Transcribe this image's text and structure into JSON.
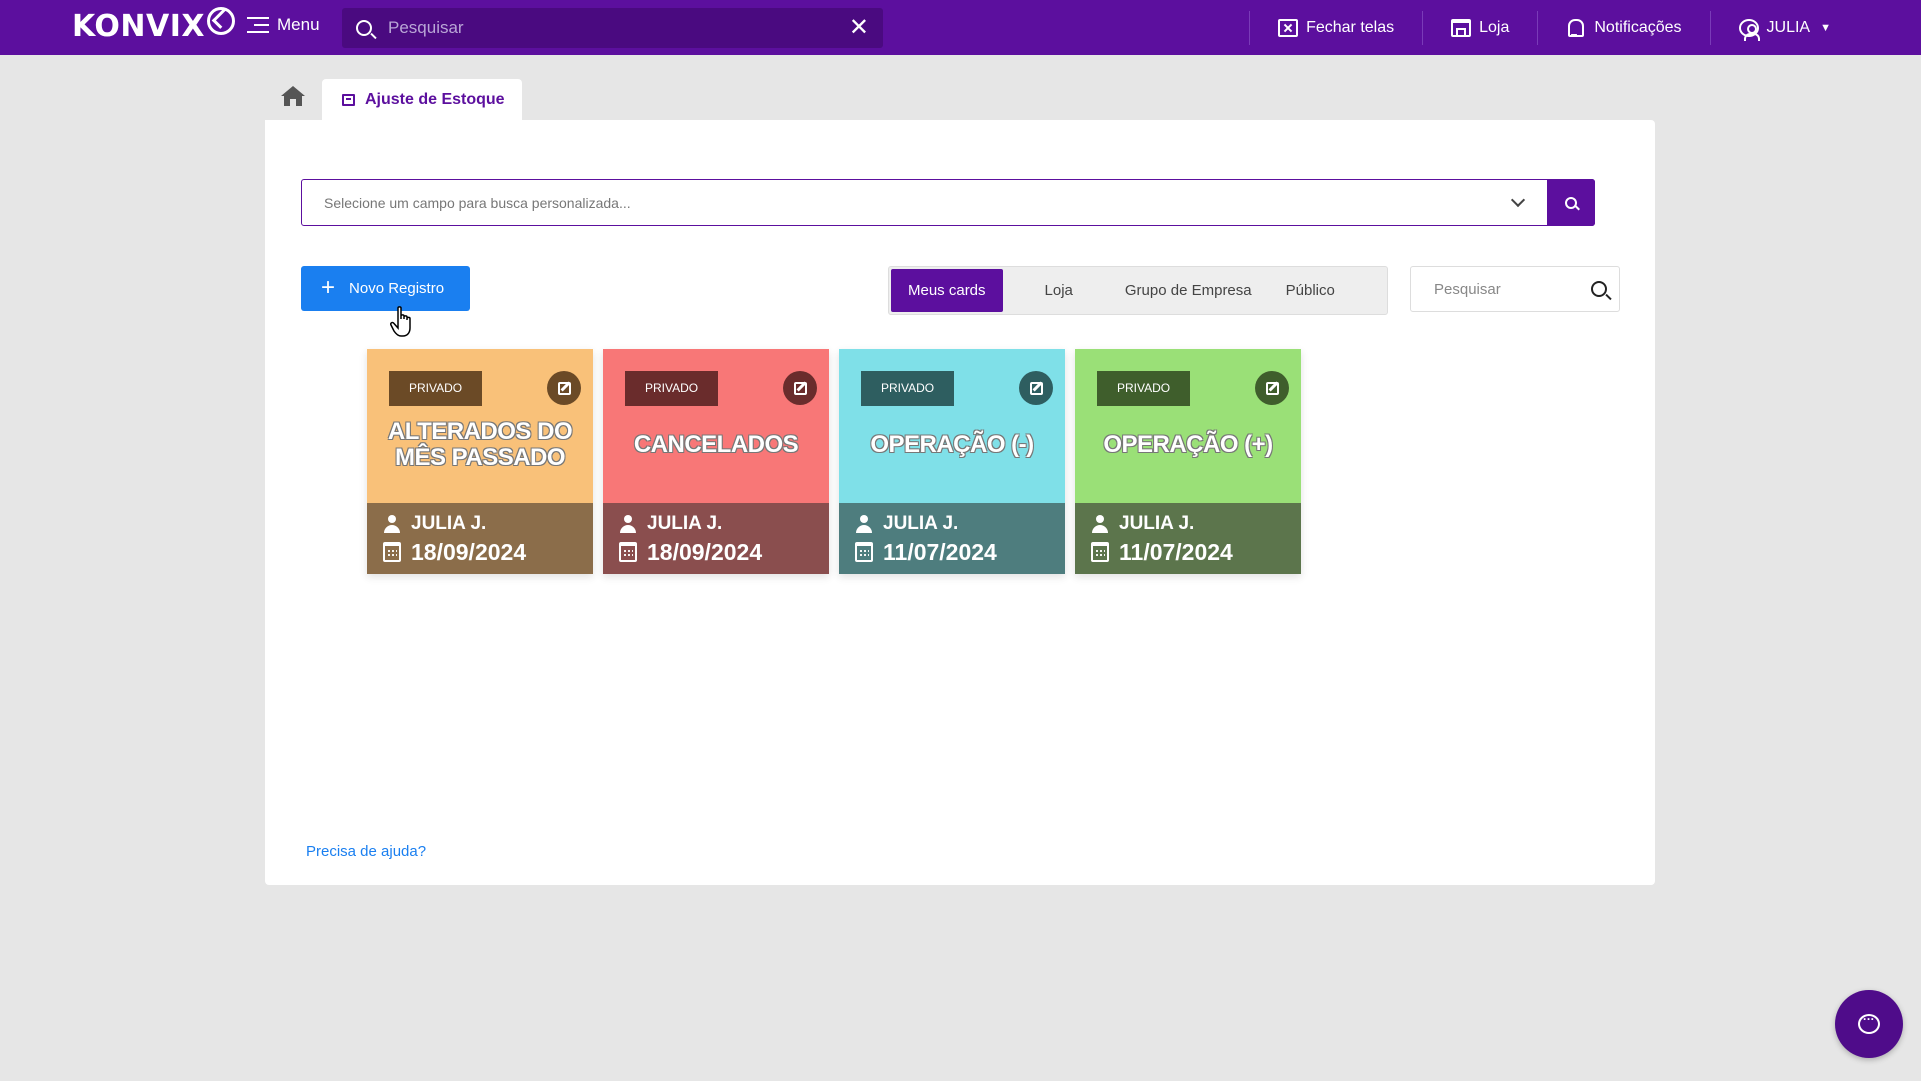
{
  "app": {
    "logo_text": "KONVIX",
    "menu_label": "Menu",
    "search_placeholder": "Pesquisar"
  },
  "topbar": {
    "close_windows_label": "Fechar telas",
    "store_label": "Loja",
    "notifications_label": "Notificações",
    "user_label": "JULIA"
  },
  "tabs": {
    "active_label": "Ajuste de Estoque"
  },
  "filters": {
    "field_search_placeholder": "Selecione um campo para busca personalizada...",
    "new_record_label": "Novo Registro",
    "segments": [
      "Meus cards",
      "Loja",
      "Grupo de Empresa",
      "Público"
    ],
    "active_segment": "Meus cards",
    "card_search_placeholder": "Pesquisar"
  },
  "cards": [
    {
      "badge": "PRIVADO",
      "title": "ALTERADOS DO MÊS PASSADO",
      "user": "JULIA J.",
      "date": "18/09/2024",
      "top_color": "#f9c179",
      "bottom_color": "#8b6d4a",
      "badge_color": "#6b4a26",
      "edit_color": "#6b4a26"
    },
    {
      "badge": "PRIVADO",
      "title": "CANCELADOS",
      "user": "JULIA J.",
      "date": "18/09/2024",
      "top_color": "#f87777",
      "bottom_color": "#8a4e4e",
      "badge_color": "#6a2c2c",
      "edit_color": "#6a2c2c"
    },
    {
      "badge": "PRIVADO",
      "title": "OPERAÇÃO (-)",
      "user": "JULIA J.",
      "date": "11/07/2024",
      "top_color": "#7fe0e8",
      "bottom_color": "#4e7d7e",
      "badge_color": "#2e5e60",
      "edit_color": "#2e5e60"
    },
    {
      "badge": "PRIVADO",
      "title": "OPERAÇÃO (+)",
      "user": "JULIA J.",
      "date": "11/07/2024",
      "top_color": "#9ae077",
      "bottom_color": "#5c754c",
      "badge_color": "#3f5e2c",
      "edit_color": "#3f5e2c"
    }
  ],
  "help_link": "Precisa de ajuda?",
  "theme": {
    "primary": "#5c0f9e",
    "button_blue": "#1a7ff0"
  }
}
